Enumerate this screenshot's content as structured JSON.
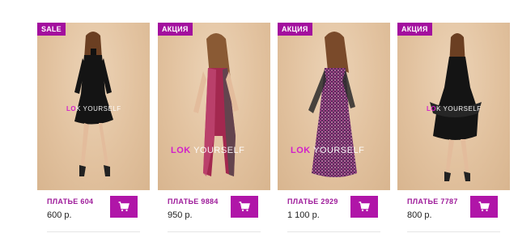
{
  "products": [
    {
      "badge": "SALE",
      "name": "ПЛАТЬЕ 604",
      "price": "600 р."
    },
    {
      "badge": "АКЦИЯ",
      "name": "ПЛАТЬЕ 9884",
      "price": "950 р."
    },
    {
      "badge": "АКЦИЯ",
      "name": "ПЛАТЬЕ 2929",
      "price": "1 100 р."
    },
    {
      "badge": "АКЦИЯ",
      "name": "ПЛАТЬЕ 7787",
      "price": "800 р."
    }
  ],
  "watermark": {
    "lo": "LO",
    "k": "K",
    "rest": "YOURSELF"
  },
  "cart_icon": "shopping-cart-icon",
  "colors": {
    "accent": "#b015a8",
    "badge": "#a30f9e",
    "name_text": "#9e1b9a",
    "photo_bg": "#e4c7a6"
  }
}
